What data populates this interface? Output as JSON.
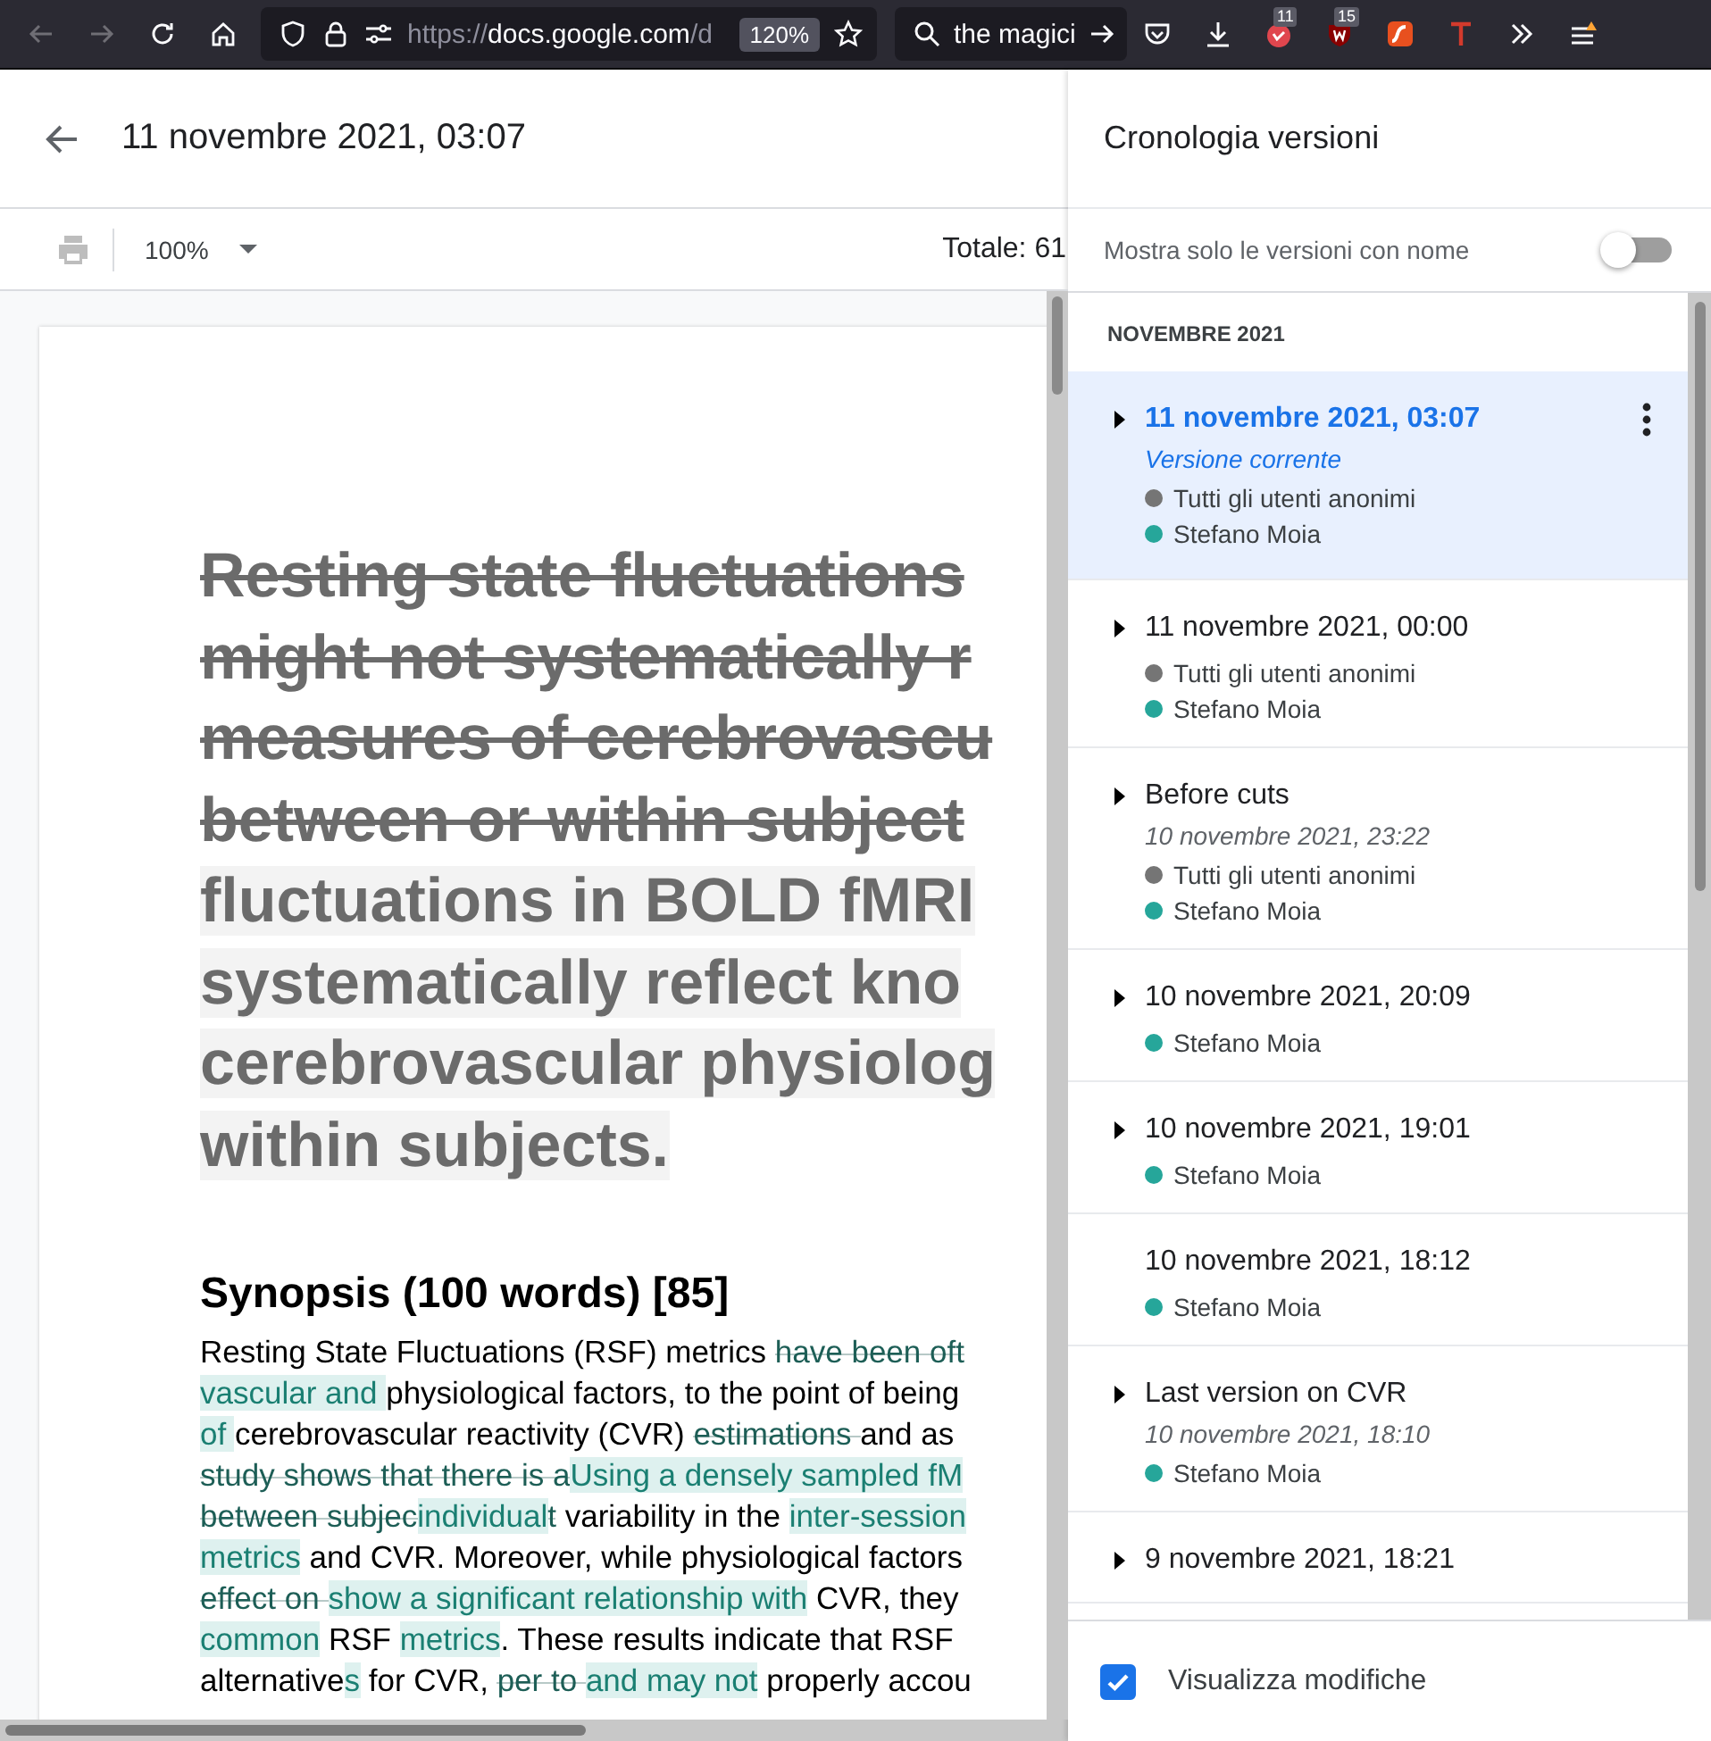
{
  "browser": {
    "url": {
      "scheme": "https://",
      "host": "docs.google.com",
      "path": "/d"
    },
    "zoom": "120%",
    "search": "the magici",
    "extension_badges": [
      "11",
      "15"
    ]
  },
  "document": {
    "title": "11 novembre 2021, 03:07",
    "zoom": "100%",
    "word_count": "Totale: 61",
    "heading_lines": [
      {
        "text": "Resting state fluctuations",
        "kind": "deleted"
      },
      {
        "text": "might not systematically r",
        "kind": "deleted"
      },
      {
        "text": "measures of cerebrovascu",
        "kind": "deleted"
      },
      {
        "text": "between or within subject",
        "kind": "deleted"
      },
      {
        "text": "fluctuations in BOLD fMRI",
        "kind": "normal"
      },
      {
        "text": "systematically reflect kno",
        "kind": "normal"
      },
      {
        "text": "cerebrovascular physiolog",
        "kind": "normal"
      },
      {
        "text": "within subjects.",
        "kind": "normal"
      }
    ],
    "section_heading": "Synopsis (100 words) [85]",
    "paragraph_lines": [
      [
        {
          "text": "Resting State Fluctuations (RSF) metrics ",
          "kind": "normal"
        },
        {
          "text": "have been oft",
          "kind": "deleted"
        }
      ],
      [
        {
          "text": "vascular and ",
          "kind": "inserted"
        },
        {
          "text": "physiological factors, to the point of being",
          "kind": "normal"
        }
      ],
      [
        {
          "text": "of ",
          "kind": "inserted"
        },
        {
          "text": "cerebrovascular reactivity (CVR) ",
          "kind": "normal"
        },
        {
          "text": "estimations ",
          "kind": "deleted"
        },
        {
          "text": "and as",
          "kind": "normal"
        }
      ],
      [
        {
          "text": "study shows that there is a",
          "kind": "deleted"
        },
        {
          "text": "Using a densely sampled fM",
          "kind": "inserted"
        }
      ],
      [
        {
          "text": "between subjec",
          "kind": "deleted"
        },
        {
          "text": "individual",
          "kind": "inserted"
        },
        {
          "text": "t",
          "kind": "deleted"
        },
        {
          "text": " variability in the ",
          "kind": "normal"
        },
        {
          "text": "inter-session",
          "kind": "inserted"
        }
      ],
      [
        {
          "text": "metrics",
          "kind": "inserted"
        },
        {
          "text": " and CVR. Moreover, while physiological factors",
          "kind": "normal"
        }
      ],
      [
        {
          "text": "effect on ",
          "kind": "deleted"
        },
        {
          "text": "show a significant relationship with",
          "kind": "inserted"
        },
        {
          "text": " CVR, they",
          "kind": "normal"
        }
      ],
      [
        {
          "text": "common",
          "kind": "inserted"
        },
        {
          "text": " RSF ",
          "kind": "normal"
        },
        {
          "text": "metrics",
          "kind": "inserted"
        },
        {
          "text": ". These results indicate that RSF",
          "kind": "normal"
        }
      ],
      [
        {
          "text": "alternative",
          "kind": "normal"
        },
        {
          "text": "s",
          "kind": "inserted"
        },
        {
          "text": " for CVR, ",
          "kind": "normal"
        },
        {
          "text": "per to ",
          "kind": "deleted"
        },
        {
          "text": "and may not",
          "kind": "inserted"
        },
        {
          "text": " properly accou",
          "kind": "normal"
        }
      ]
    ]
  },
  "history": {
    "title": "Cronologia versioni",
    "named_only": {
      "label": "Mostra solo le versioni con nome",
      "on": false
    },
    "month": "NOVEMBRE 2021",
    "versions": [
      {
        "title": "11 novembre 2021, 03:07",
        "subtitle": "Versione corrente",
        "expandable": true,
        "selected": true,
        "users": [
          {
            "name": "Tutti gli utenti anonimi",
            "color": "#757575"
          },
          {
            "name": "Stefano Moia",
            "color": "#26a69a"
          }
        ]
      },
      {
        "title": "11 novembre 2021, 00:00",
        "expandable": true,
        "selected": false,
        "users": [
          {
            "name": "Tutti gli utenti anonimi",
            "color": "#757575"
          },
          {
            "name": "Stefano Moia",
            "color": "#26a69a"
          }
        ]
      },
      {
        "title": "Before cuts",
        "subtitle": "10 novembre 2021, 23:22",
        "expandable": true,
        "selected": false,
        "users": [
          {
            "name": "Tutti gli utenti anonimi",
            "color": "#757575"
          },
          {
            "name": "Stefano Moia",
            "color": "#26a69a"
          }
        ]
      },
      {
        "title": "10 novembre 2021, 20:09",
        "expandable": true,
        "selected": false,
        "users": [
          {
            "name": "Stefano Moia",
            "color": "#26a69a"
          }
        ]
      },
      {
        "title": "10 novembre 2021, 19:01",
        "expandable": true,
        "selected": false,
        "users": [
          {
            "name": "Stefano Moia",
            "color": "#26a69a"
          }
        ]
      },
      {
        "title": "10 novembre 2021, 18:12",
        "expandable": false,
        "selected": false,
        "users": [
          {
            "name": "Stefano Moia",
            "color": "#26a69a"
          }
        ]
      },
      {
        "title": "Last version on CVR",
        "subtitle": "10 novembre 2021, 18:10",
        "expandable": true,
        "selected": false,
        "users": [
          {
            "name": "Stefano Moia",
            "color": "#26a69a"
          }
        ]
      },
      {
        "title": "9 novembre 2021, 18:21",
        "expandable": true,
        "selected": false
      }
    ],
    "show_changes": {
      "label": "Visualizza modifiche",
      "checked": true
    }
  }
}
